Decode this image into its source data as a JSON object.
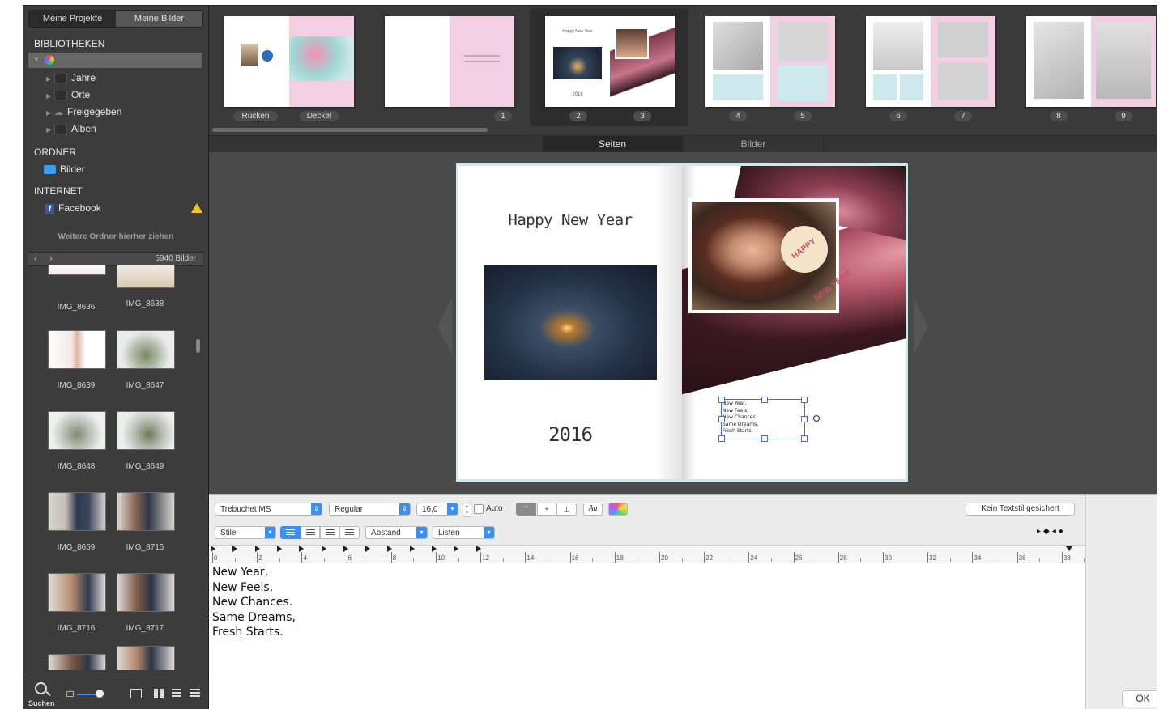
{
  "sidebar": {
    "tabs": [
      "Meine Projekte",
      "Meine Bilder"
    ],
    "libraries_header": "BIBLIOTHEKEN",
    "library_items": [
      "Jahre",
      "Orte",
      "Freigegeben",
      "Alben"
    ],
    "folders_header": "ORDNER",
    "folder_items": [
      "Bilder"
    ],
    "internet_header": "INTERNET",
    "internet_items": [
      "Facebook"
    ],
    "drop_hint": "Weitere Ordner hierher ziehen",
    "image_count": "5940 Bilder",
    "images": [
      "IMG_8636",
      "IMG_8638",
      "IMG_8639",
      "IMG_8647",
      "IMG_8648",
      "IMG_8649",
      "IMG_8659",
      "IMG_8715",
      "IMG_8716",
      "IMG_8717"
    ],
    "search_label": "Suchen"
  },
  "strip": {
    "pills": [
      "Rücken",
      "Deckel",
      "1",
      "2",
      "3",
      "4",
      "5",
      "6",
      "7",
      "8",
      "9"
    ],
    "mini_title": "Happy New Year",
    "mini_year": "2016"
  },
  "view_tabs": [
    "Seiten",
    "Bilder"
  ],
  "page": {
    "title": "Happy New Year",
    "year": "2016",
    "sign_text": "HAPPY NEW YEAR"
  },
  "toolbar": {
    "font": "Trebuchet MS",
    "style": "Regular",
    "size": "16,0",
    "auto_label": "Auto",
    "aa_label": "Aa",
    "kein_textstil": "Kein Textstil gesichert",
    "stile": "Stile",
    "abstand": "Abstand",
    "listen": "Listen"
  },
  "ruler": [
    "0",
    "2",
    "4",
    "6",
    "8",
    "10",
    "12",
    "14",
    "16",
    "18",
    "20",
    "22",
    "24",
    "26",
    "28",
    "30",
    "32",
    "34",
    "36",
    "38"
  ],
  "text_lines": [
    "New Year,",
    "New Feels,",
    "New Chances.",
    "Same Dreams,",
    "Fresh Starts."
  ],
  "ok_label": "OK",
  "colors": {
    "accent": "#3b8ff0",
    "pink": "#f3cde3",
    "dark": "#3a3a3a"
  }
}
